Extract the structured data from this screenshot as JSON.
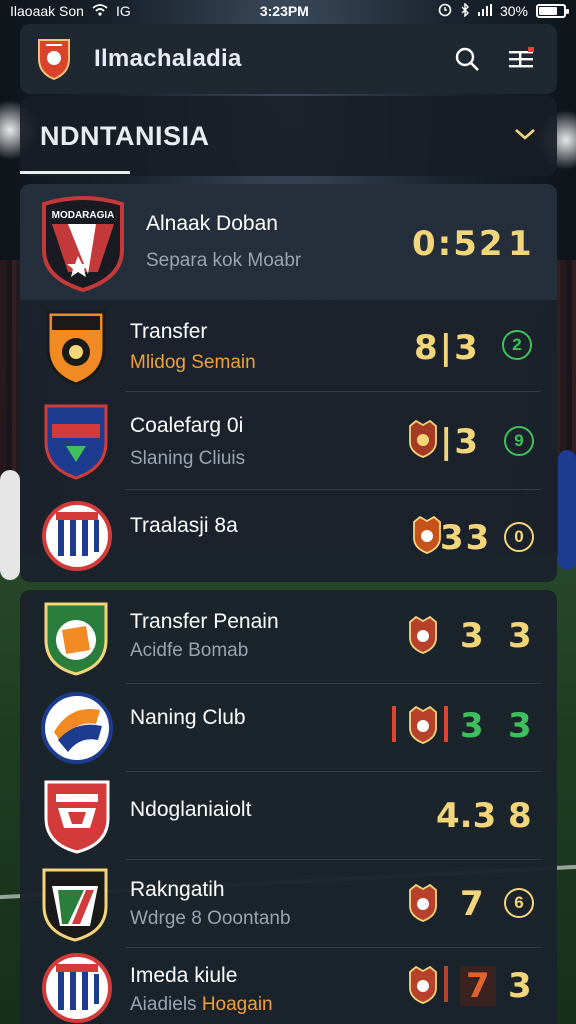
{
  "status_bar": {
    "carrier": "Ilaoaak Son",
    "network": "IG",
    "time": "3:23PM",
    "battery": "30%"
  },
  "header": {
    "app_title": "Ilmachaladia",
    "icons": [
      "club-crest-icon",
      "search-icon",
      "menu-icon"
    ]
  },
  "section": {
    "title": "NDNTANISIA",
    "toggle_icon": "chevron-down-icon"
  },
  "colors": {
    "accent_yellow": "#f3d67a",
    "accent_green": "#3ec15a",
    "accent_orange": "#f0a13a",
    "accent_red": "#e0432e",
    "panel_bg": "#1b222c"
  },
  "crest_text": "MODARAGIA",
  "rows": [
    {
      "name": "Alnaak Doban",
      "sub": "Separa kok Moabr",
      "score": "0:52",
      "pts": "1"
    },
    {
      "name": "Transfer",
      "sub": "Mlidog Semain",
      "score": "8|3",
      "badge": "2"
    },
    {
      "name": "Coalefarg 0i",
      "sub": "Slaning Cliuis",
      "score": "|3",
      "badge": "9"
    },
    {
      "name": "Traalasji 8a",
      "sub": "",
      "score": "33",
      "badge": "0"
    },
    {
      "name": "Transfer Penain",
      "sub": "Acidfe Bomab",
      "score": "3",
      "pts": "3"
    },
    {
      "name": "Naning Club",
      "sub": "",
      "score": "3",
      "pts": "3"
    },
    {
      "name": "Ndoglaniaiolt",
      "sub": "",
      "score": "4.3",
      "pts": "8"
    },
    {
      "name": "Rakngatih",
      "sub": "Wdrge 8 Ooontanb",
      "score": "7",
      "badge": "6"
    },
    {
      "name": "Imeda kiule",
      "sub_plain": "Aiadiels",
      "sub_accent": "Hoagain",
      "score": "7",
      "pts": "3"
    }
  ]
}
